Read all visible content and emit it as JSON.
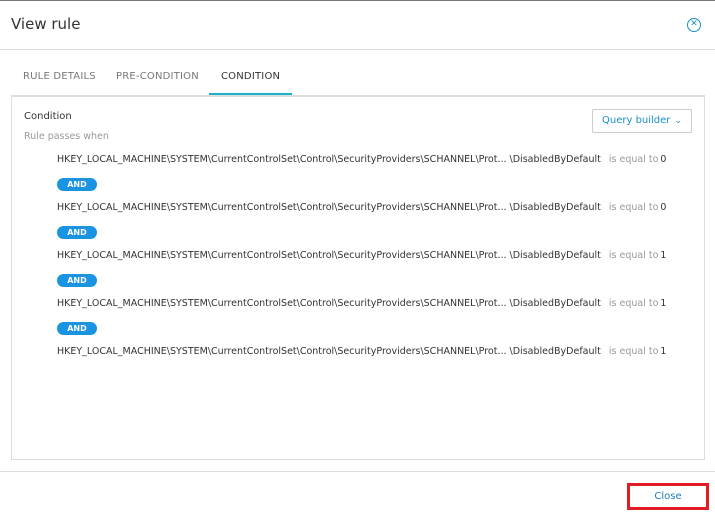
{
  "dialog": {
    "title": "View rule",
    "close_icon": "close-circle-icon"
  },
  "tabs": [
    {
      "label": "RULE DETAILS"
    },
    {
      "label": "PRE-CONDITION"
    },
    {
      "label": "CONDITION",
      "active": true
    }
  ],
  "condition": {
    "label": "Condition",
    "subtitle": "Rule passes when",
    "query_builder_label": "Query builder",
    "rows": [
      {
        "key": "HKEY_LOCAL_MACHINE\\SYSTEM\\CurrentControlSet\\Control\\SecurityProviders\\SCHANNEL\\Prot... \\DisabledByDefault",
        "operator": "is equal to",
        "value": "0"
      },
      {
        "key": "HKEY_LOCAL_MACHINE\\SYSTEM\\CurrentControlSet\\Control\\SecurityProviders\\SCHANNEL\\Prot... \\DisabledByDefault",
        "operator": "is equal to",
        "value": "0"
      },
      {
        "key": "HKEY_LOCAL_MACHINE\\SYSTEM\\CurrentControlSet\\Control\\SecurityProviders\\SCHANNEL\\Prot... \\DisabledByDefault",
        "operator": "is equal to",
        "value": "1"
      },
      {
        "key": "HKEY_LOCAL_MACHINE\\SYSTEM\\CurrentControlSet\\Control\\SecurityProviders\\SCHANNEL\\Prot... \\DisabledByDefault",
        "operator": "is equal to",
        "value": "1"
      },
      {
        "key": "HKEY_LOCAL_MACHINE\\SYSTEM\\CurrentControlSet\\Control\\SecurityProviders\\SCHANNEL\\Prot... \\DisabledByDefault",
        "operator": "is equal to",
        "value": "1"
      }
    ],
    "connector": "AND"
  },
  "footer": {
    "close_label": "Close"
  },
  "colors": {
    "accent": "#1a8fc9",
    "tab_underline": "#1ab3c9",
    "and_pill": "#1a94e0",
    "highlight": "#e31b23"
  }
}
